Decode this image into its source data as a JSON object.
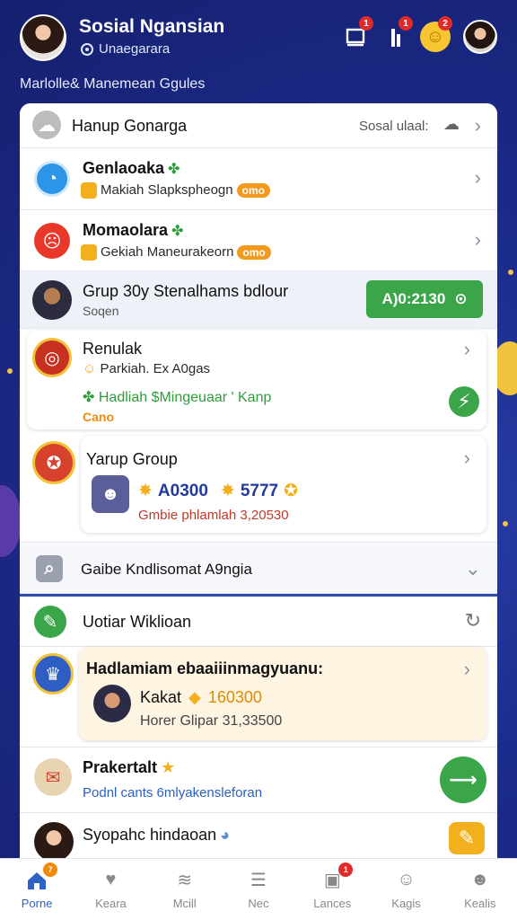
{
  "header": {
    "title": "Sosial Ngansian",
    "subtitle": "Unaegarara",
    "tagline": "Marlolle& Manemean Ggules",
    "badges": {
      "notification": "1",
      "tools": "1",
      "coins": "2"
    }
  },
  "group_header": {
    "title": "Hanup Gonarga",
    "action": "Sosal ulaal:"
  },
  "items": [
    {
      "title": "Genlaoaka",
      "subtitle": "Makiah Slapkspheogn",
      "pill": "omo"
    },
    {
      "title": "Momaolara",
      "subtitle": "Gekiah Maneurakeorn",
      "pill": "omo"
    },
    {
      "title": "Grup 30y Stenalhams bdlour",
      "subtitle": "Soqen",
      "button": "A)0:2130"
    },
    {
      "title": "Renulak",
      "subtitle": "Parkiah. Ex A0gas",
      "note": "Hadliah $Mingeuaar ' Kanp",
      "note2": "Cano"
    },
    {
      "title": "Yarup Group",
      "stat1": "A0300",
      "stat2": "5777",
      "note": "Gmbie phlamlah 3,20530"
    }
  ],
  "collapse_row": {
    "title": "Gaibe Kndlisomat A9ngia"
  },
  "section2": {
    "title": "Uotiar Wiklioan"
  },
  "highlight": {
    "title": "Hadlamiam ebaaiiinmagyuanu:",
    "name": "Kakat",
    "amount": "160300",
    "note": "Horer Glipar 31,33500"
  },
  "row_praktal": {
    "title": "Prakertalt",
    "link": "Podnl cants 6mlyakensleforan"
  },
  "row_last": {
    "title": "Syopahc hindaoan"
  },
  "nav": [
    {
      "label": "Porne",
      "badge": "7"
    },
    {
      "label": "Keara"
    },
    {
      "label": "Mcill"
    },
    {
      "label": "Nec"
    },
    {
      "label": "Lances",
      "badge": "1"
    },
    {
      "label": "Kagis"
    },
    {
      "label": "Kealis"
    }
  ],
  "colors": {
    "accent": "#2f62c7",
    "green": "#3aa549",
    "background": "#1c2c8c",
    "badge": "#e12a2a"
  }
}
